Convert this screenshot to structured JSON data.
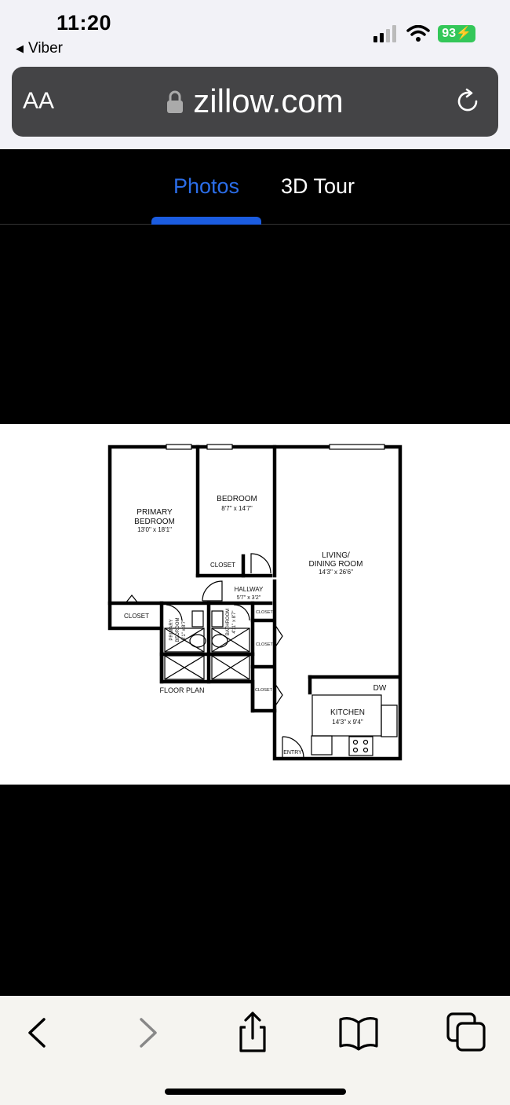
{
  "status_bar": {
    "time": "11:20",
    "back_app": "Viber",
    "battery": "93"
  },
  "url_bar": {
    "text_size_label": "AA",
    "domain": "zillow.com"
  },
  "tabs": [
    {
      "label": "Photos",
      "selected": true
    },
    {
      "label": "3D Tour",
      "selected": false
    }
  ],
  "floor_plan": {
    "rooms": {
      "primary_bedroom_line1": "PRIMARY",
      "primary_bedroom_line2": "BEDROOM",
      "primary_bedroom_size": "13'0\" x 18'1\"",
      "bedroom": "BEDROOM",
      "bedroom_size": "8'7\" x 14'7\"",
      "living_line1": "LIVING/",
      "living_line2": "DINING ROOM",
      "living_size": "14'3\" x 26'6\"",
      "closet": "CLOSET",
      "hallway": "HALLWAY",
      "hallway_size": "5'7\" x 3'2\"",
      "primary_bath_line1": "PRIMARY",
      "primary_bath_line2": "BEDROOM",
      "primary_bath_size": "5'1\" x 8'7\"",
      "bathroom": "BATHROOM",
      "bathroom_size": "4'11\" x 8'7\"",
      "dw": "DW",
      "kitchen": "KITCHEN",
      "kitchen_size": "14'3\" x 9'4\"",
      "entry": "ENTRY",
      "floor_plan_label": "FLOOR PLAN"
    }
  },
  "toolbar": {
    "icons": [
      "back-icon",
      "forward-icon",
      "share-icon",
      "bookmarks-icon",
      "tabs-icon"
    ]
  },
  "colors": {
    "accent": "#2b6de8",
    "battery": "#34c759"
  }
}
